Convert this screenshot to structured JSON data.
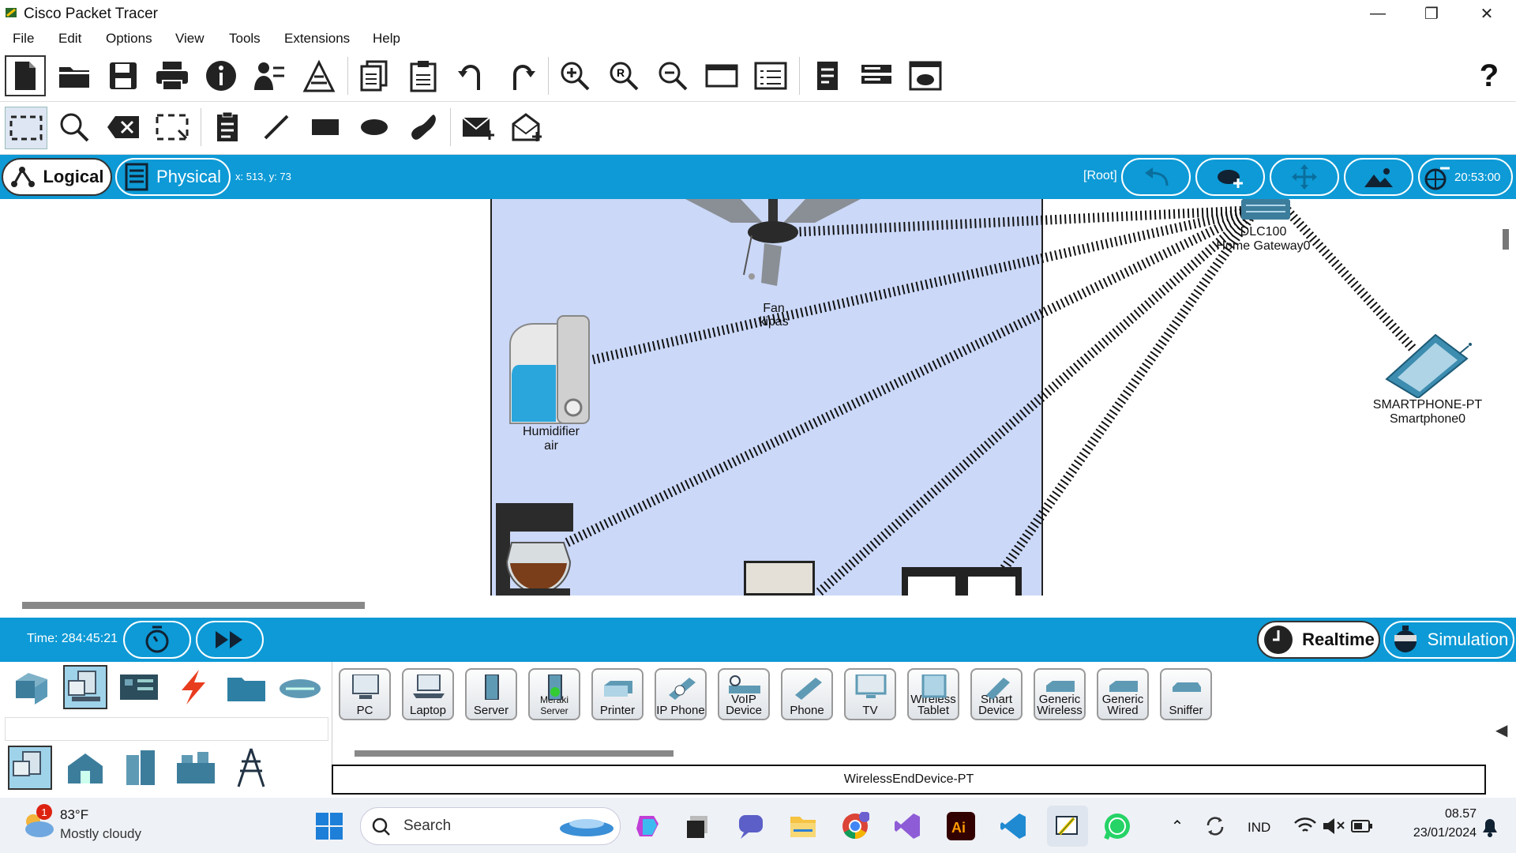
{
  "window": {
    "title": "Cisco Packet Tracer"
  },
  "menu": [
    "File",
    "Edit",
    "Options",
    "View",
    "Tools",
    "Extensions",
    "Help"
  ],
  "mode": {
    "logical_label": "Logical",
    "physical_label": "Physical",
    "coords": "x: 513, y: 73",
    "root_label": "[Root]",
    "clock": "20:53:00"
  },
  "workspace": {
    "devices": [
      {
        "name": "Fan",
        "sub": "kipas"
      },
      {
        "name": "Humidifier",
        "sub": "air"
      },
      {
        "name": "DLC100",
        "sub": "Home Gateway0"
      },
      {
        "name": "SMARTPHONE-PT",
        "sub": "Smartphone0"
      }
    ]
  },
  "timebar": {
    "time": "Time: 284:45:21",
    "realtime_label": "Realtime",
    "simulation_label": "Simulation"
  },
  "device_panel": {
    "devices": [
      "PC",
      "Laptop",
      "Server",
      "Meraki Server",
      "Printer",
      "IP Phone",
      "VoIP Device",
      "Phone",
      "TV",
      "Wireless Tablet",
      "Smart Device",
      "Generic Wireless",
      "Generic Wired",
      "Sniffer"
    ],
    "selected_model": "WirelessEndDevice-PT"
  },
  "taskbar": {
    "weather_temp": "83°F",
    "weather_desc": "Mostly cloudy",
    "weather_badge": "1",
    "search_label": "Search",
    "language": "IND",
    "time": "08.57",
    "date": "23/01/2024"
  },
  "colors": {
    "accent": "#0d9ad6",
    "room": "#cbd8f8"
  }
}
